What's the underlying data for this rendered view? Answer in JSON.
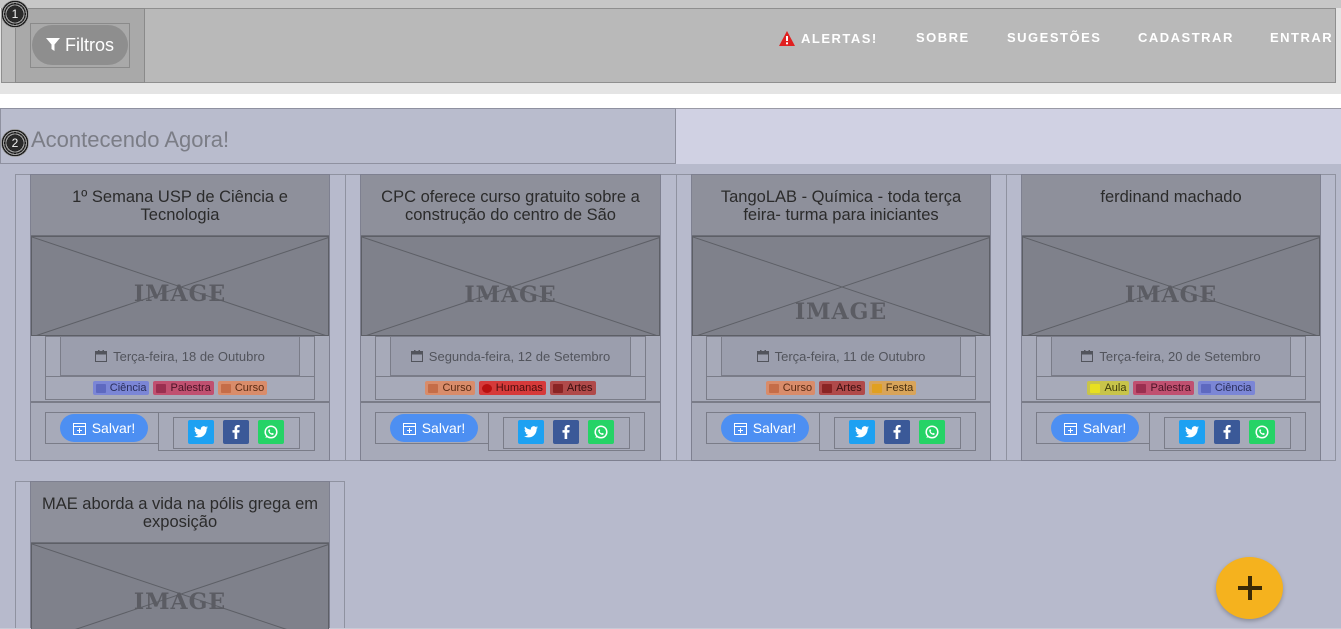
{
  "navbar": {
    "filter_label": "Filtros",
    "links": [
      {
        "label": "ALERTAS!",
        "icon": "warning-icon"
      },
      {
        "label": "SOBRE"
      },
      {
        "label": "SUGESTÕES"
      },
      {
        "label": "CADASTRAR"
      },
      {
        "label": "ENTRAR"
      }
    ]
  },
  "section": {
    "title": "Acontecendo Agora!"
  },
  "markers": [
    "1",
    "2"
  ],
  "cards": [
    {
      "title": "1º Semana USP de Ciência e Tecnologia",
      "image_label": "IMAGE",
      "date": "Terça-feira, 18 de Outubro",
      "tags": [
        "Ciência",
        "Palestra",
        "Curso"
      ],
      "save_label": "Salvar!"
    },
    {
      "title": "CPC oferece curso gratuito sobre a construção do centro de São",
      "image_label": "IMAGE",
      "date": "Segunda-feira, 12 de Setembro",
      "tags": [
        "Curso",
        "Humanas",
        "Artes"
      ],
      "save_label": "Salvar!"
    },
    {
      "title": "TangoLAB - Química - toda terça feira- turma para iniciantes",
      "image_label": "IMAGE",
      "date": "Terça-feira, 11 de Outubro",
      "tags": [
        "Curso",
        "Artes",
        "Festa"
      ],
      "save_label": "Salvar!"
    },
    {
      "title": "ferdinand machado",
      "image_label": "IMAGE",
      "date": "Terça-feira, 20 de Setembro",
      "tags": [
        "Aula",
        "Palestra",
        "Ciência"
      ],
      "save_label": "Salvar!"
    },
    {
      "title": "MAE aborda a vida na pólis grega em exposição",
      "image_label": "IMAGE"
    }
  ],
  "colors": {
    "save": "#4d8ff2",
    "twitter": "#1da1f2",
    "facebook": "#3b5998",
    "whatsapp": "#25d366",
    "fab": "#f5b21e",
    "tag_ciencia": "#7b86d6",
    "tag_palestra": "#c05070",
    "tag_curso": "#d98c6a",
    "tag_humanas": "#d63a3a",
    "tag_artes": "#b04a4a",
    "tag_festa": "#d8a45a",
    "tag_aula": "#c8c44a"
  },
  "fab": {
    "label": "+",
    "icon": "plus-icon"
  }
}
